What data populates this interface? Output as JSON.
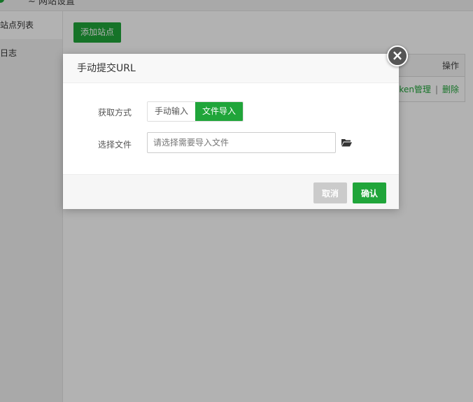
{
  "topbar": {
    "title_fragment": "~ 网站设置"
  },
  "sidebar": {
    "items": [
      {
        "label": "站点列表"
      },
      {
        "label": "日志"
      }
    ]
  },
  "content": {
    "add_button": "添加站点",
    "table": {
      "header_operation": "操作",
      "row_ops": {
        "token_manage": "ken管理",
        "separator": "|",
        "delete": "删除"
      }
    }
  },
  "dialog": {
    "title": "手动提交URL",
    "close_glyph": "×",
    "method": {
      "label": "获取方式",
      "options": [
        "手动输入",
        "文件导入"
      ],
      "selected": "文件导入"
    },
    "file": {
      "label": "选择文件",
      "placeholder": "请选择需要导入文件",
      "value": ""
    },
    "buttons": {
      "cancel": "取消",
      "confirm": "确认"
    }
  },
  "colors": {
    "accent": "#20a53a",
    "cancel": "#cbcbcb",
    "close": "#555555"
  },
  "icons": {
    "folder": "folder-open-icon",
    "close": "close-icon"
  }
}
